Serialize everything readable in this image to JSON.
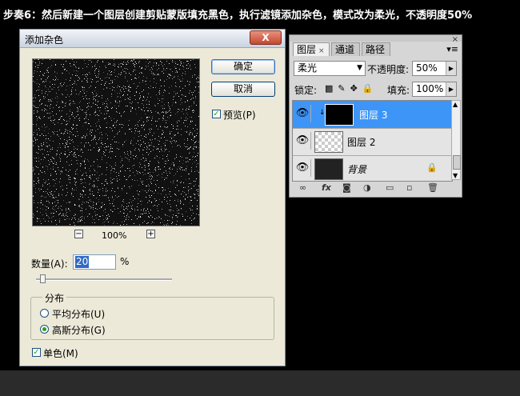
{
  "step_text": "步奏6：然后新建一个图层创建剪贴蒙版填充黑色，执行滤镜添加杂色，模式改为柔光，不透明度50%",
  "dialog": {
    "title": "添加杂色",
    "close_label": "X",
    "ok_label": "确定",
    "cancel_label": "取消",
    "preview_label": "预览(P)",
    "preview_checked": true,
    "zoom_out": "−",
    "zoom_in": "+",
    "zoom_level": "100%",
    "amount_label": "数量(A):",
    "amount_value": "20",
    "amount_unit": "%",
    "distribution_title": "分布",
    "uniform_label": "平均分布(U)",
    "gaussian_label": "高斯分布(G)",
    "selected_distribution": "gaussian",
    "monochrome_label": "单色(M)",
    "monochrome_checked": true
  },
  "layers_panel": {
    "close": "×",
    "tabs": [
      {
        "label": "图层",
        "active": true,
        "close": "×"
      },
      {
        "label": "通道",
        "active": false
      },
      {
        "label": "路径",
        "active": false
      }
    ],
    "menu_icon": "▾≡",
    "blend_mode": "柔光",
    "opacity_label": "不透明度:",
    "opacity_value": "50%",
    "lock_label": "锁定:",
    "fill_label": "填充:",
    "fill_value": "100%",
    "layers": [
      {
        "name": "图层 3",
        "selected": true,
        "clipped": true
      },
      {
        "name": "图层 2",
        "selected": false
      },
      {
        "name": "背景",
        "selected": false,
        "locked": true
      }
    ]
  }
}
